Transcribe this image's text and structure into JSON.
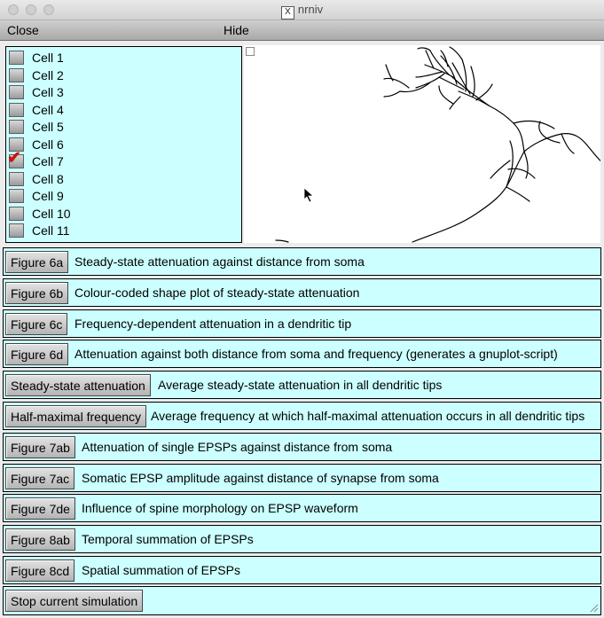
{
  "window": {
    "title": "nrniv"
  },
  "menu": {
    "close": "Close",
    "hide": "Hide"
  },
  "cells": [
    {
      "label": "Cell 1",
      "checked": false
    },
    {
      "label": "Cell 2",
      "checked": false
    },
    {
      "label": "Cell 3",
      "checked": false
    },
    {
      "label": "Cell 4",
      "checked": false
    },
    {
      "label": "Cell 5",
      "checked": false
    },
    {
      "label": "Cell 6",
      "checked": false
    },
    {
      "label": "Cell 7",
      "checked": true
    },
    {
      "label": "Cell 8",
      "checked": false
    },
    {
      "label": "Cell 9",
      "checked": false
    },
    {
      "label": "Cell 10",
      "checked": false
    },
    {
      "label": "Cell 11",
      "checked": false
    }
  ],
  "figures": [
    {
      "button": "Figure 6a",
      "desc": "Steady-state attenuation against distance from soma"
    },
    {
      "button": "Figure 6b",
      "desc": "Colour-coded shape plot of steady-state attenuation"
    },
    {
      "button": "Figure 6c",
      "desc": "Frequency-dependent attenuation in a dendritic tip"
    },
    {
      "button": "Figure 6d",
      "desc": "Attenuation against both distance from soma and frequency (generates a gnuplot-script)"
    },
    {
      "button": "Steady-state attenuation",
      "desc": "Average steady-state attenuation in all dendritic tips"
    },
    {
      "button": "Half-maximal frequency",
      "desc": "Average frequency at which half-maximal attenuation occurs in all dendritic tips"
    },
    {
      "button": "Figure 7ab",
      "desc": "Attenuation of single EPSPs against distance from soma"
    },
    {
      "button": "Figure 7ac",
      "desc": "Somatic EPSP amplitude against distance of synapse from soma"
    },
    {
      "button": "Figure 7de",
      "desc": "Influence of spine morphology on EPSP waveform"
    },
    {
      "button": "Figure 8ab",
      "desc": "Temporal summation of EPSPs"
    },
    {
      "button": "Figure 8cd",
      "desc": "Spatial summation of EPSPs"
    }
  ],
  "stop": {
    "label": "Stop current simulation"
  }
}
